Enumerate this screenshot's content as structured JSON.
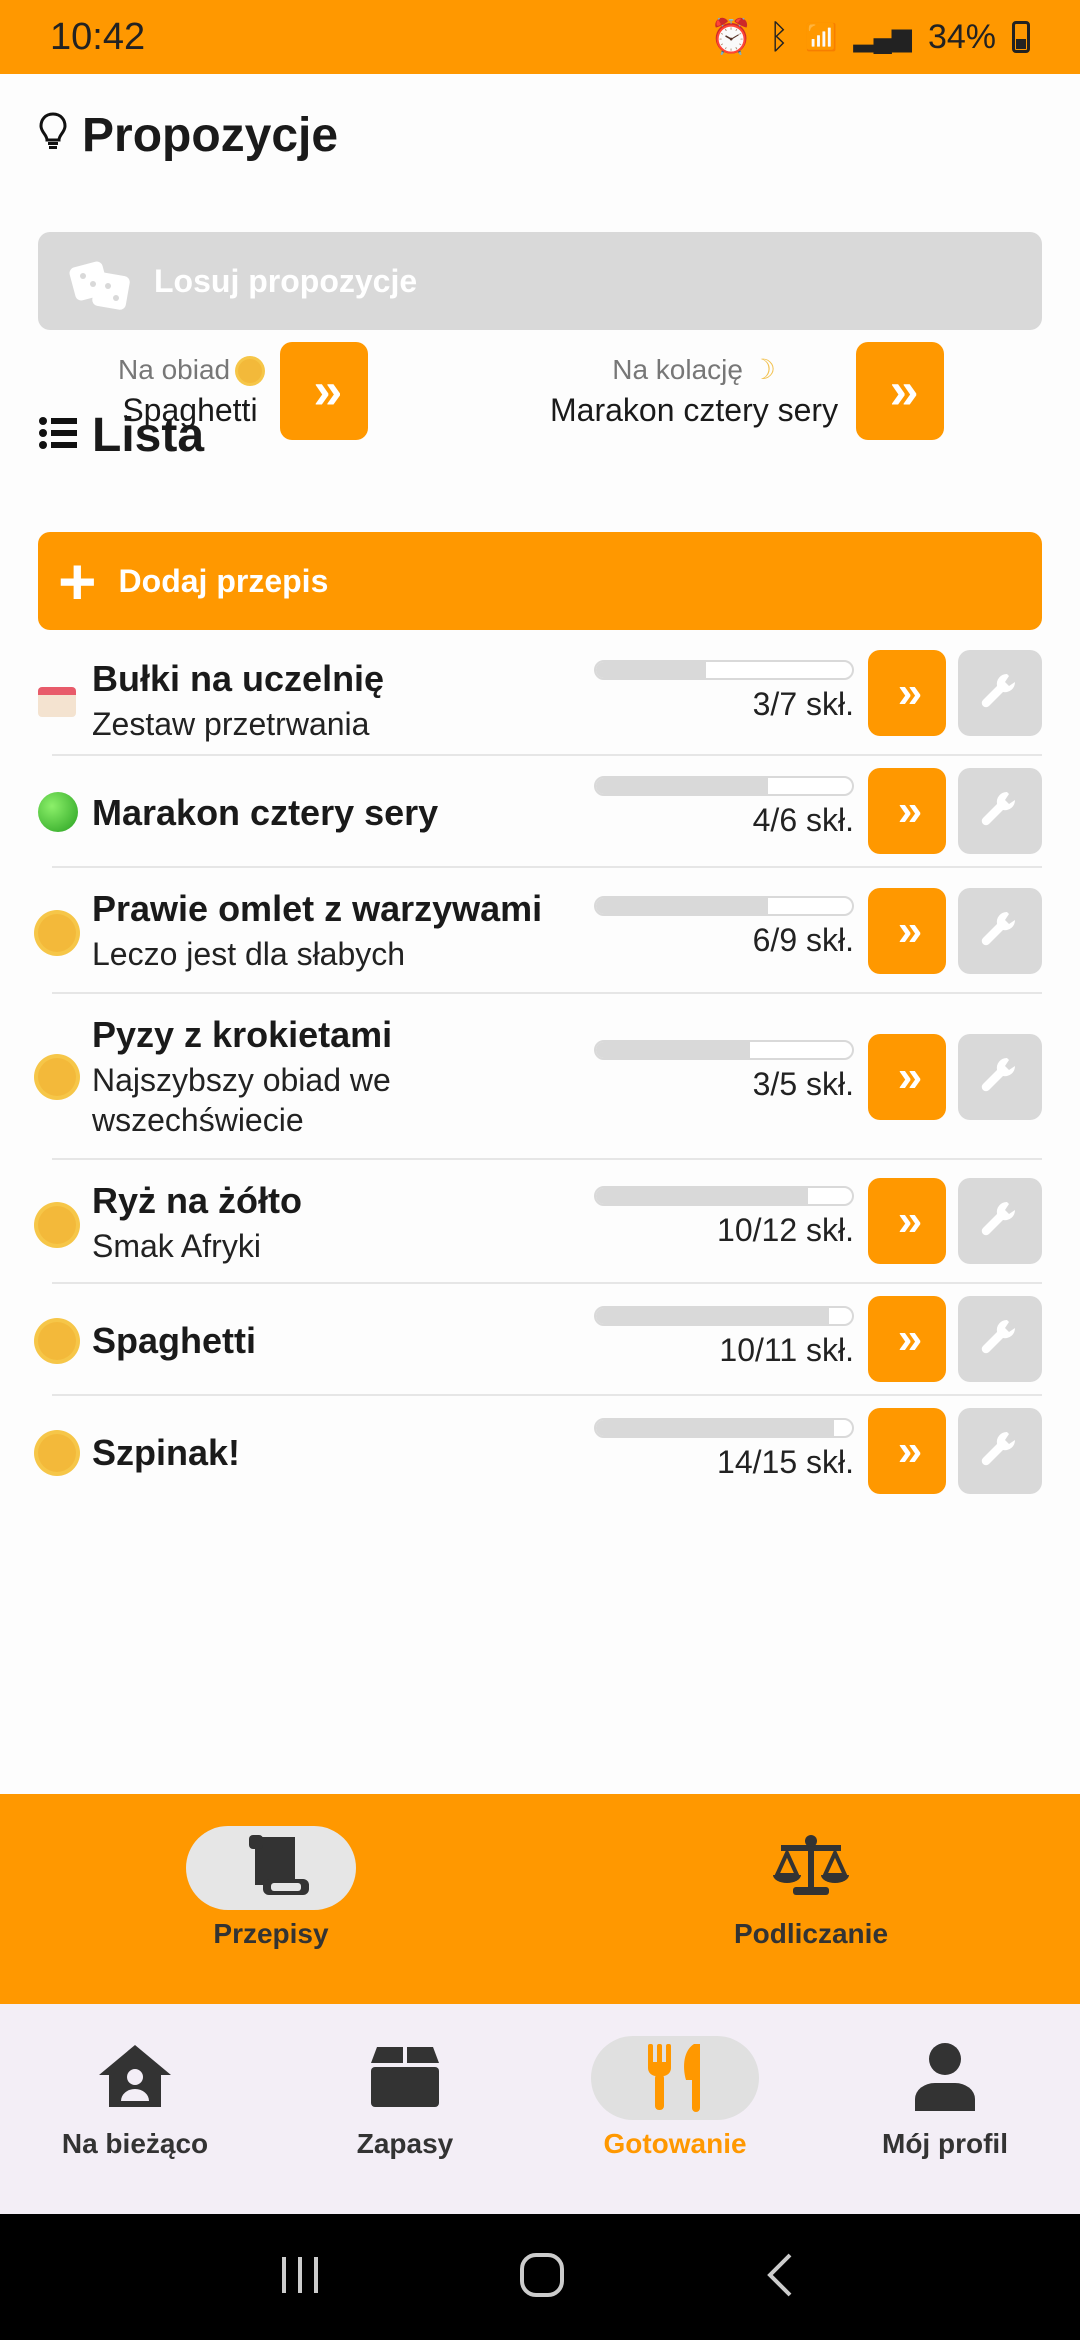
{
  "status": {
    "time": "10:42",
    "battery": "34%"
  },
  "proposals": {
    "title": "Propozycje",
    "random_label": "Losuj propozycje",
    "lunch": {
      "label": "Na obiad",
      "value": "Spaghetti"
    },
    "dinner": {
      "label": "Na kolację",
      "value": "Marakon cztery sery"
    }
  },
  "list": {
    "title": "Lista",
    "add_label": "Dodaj przepis",
    "items": [
      {
        "name": "Bułki na uczelnię",
        "subtitle": "Zestaw przetrwania",
        "count": "3/7 skł.",
        "progress": 0.43,
        "icon": "cake-icon"
      },
      {
        "name": "Marakon cztery sery",
        "subtitle": "",
        "count": "4/6 skł.",
        "progress": 0.67,
        "icon": "green-circle-icon"
      },
      {
        "name": "Prawie omlet z warzywami",
        "subtitle": "Leczo jest dla słabych",
        "count": "6/9 skł.",
        "progress": 0.67,
        "icon": "sun-icon"
      },
      {
        "name": "Pyzy z krokietami",
        "subtitle": "Najszybszy obiad we wszechświecie",
        "count": "3/5 skł.",
        "progress": 0.6,
        "icon": "sun-icon"
      },
      {
        "name": "Ryż na żółto",
        "subtitle": "Smak Afryki",
        "count": "10/12 skł.",
        "progress": 0.83,
        "icon": "sun-icon"
      },
      {
        "name": "Spaghetti",
        "subtitle": "",
        "count": "10/11 skł.",
        "progress": 0.91,
        "icon": "sun-icon"
      },
      {
        "name": "Szpinak!",
        "subtitle": "",
        "count": "14/15 skł.",
        "progress": 0.93,
        "icon": "sun-icon"
      }
    ]
  },
  "subtabs": [
    {
      "label": "Przepisy",
      "active": true
    },
    {
      "label": "Podliczanie",
      "active": false
    }
  ],
  "nav": [
    {
      "label": "Na bieżąco"
    },
    {
      "label": "Zapasy"
    },
    {
      "label": "Gotowanie"
    },
    {
      "label": "Mój profil"
    }
  ],
  "colors": {
    "accent": "#ff9800",
    "disabled": "#d9d9d9"
  }
}
